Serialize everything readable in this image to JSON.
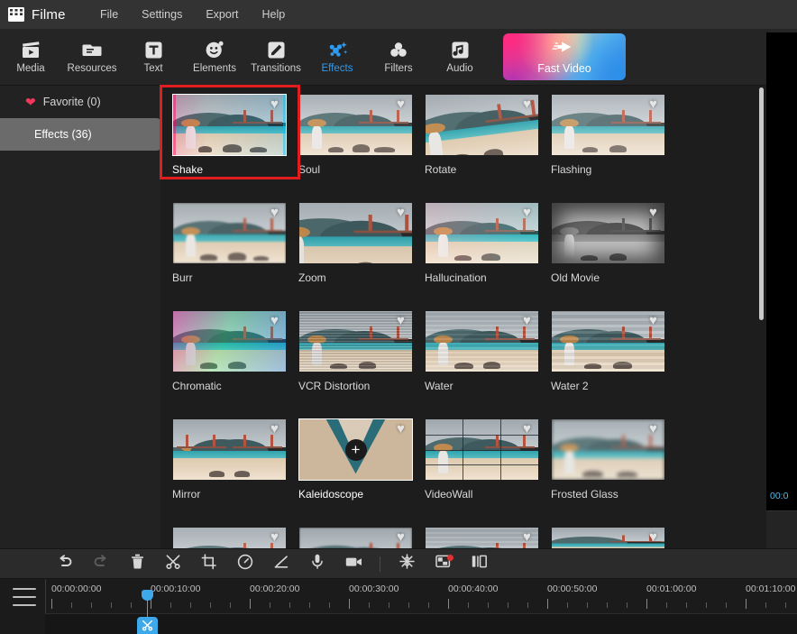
{
  "app": {
    "brand": "Filme",
    "menu": [
      "File",
      "Settings",
      "Export",
      "Help"
    ]
  },
  "ribbon": {
    "tabs": [
      {
        "label": "Media",
        "icon": "media-clapperboard-icon",
        "active": false
      },
      {
        "label": "Resources",
        "icon": "resources-folder-icon",
        "active": false
      },
      {
        "label": "Text",
        "icon": "text-t-icon",
        "active": false
      },
      {
        "label": "Elements",
        "icon": "elements-smiley-icon",
        "active": false
      },
      {
        "label": "Transitions",
        "icon": "transitions-slash-icon",
        "active": false
      },
      {
        "label": "Effects",
        "icon": "effects-sparkle-icon",
        "active": true
      },
      {
        "label": "Filters",
        "icon": "filters-circles-icon",
        "active": false
      },
      {
        "label": "Audio",
        "icon": "audio-note-icon",
        "active": false
      }
    ],
    "fast_video": {
      "label": "Fast Video",
      "icon": "fast-arrow-icon"
    },
    "accent_color": "#2f9bf0"
  },
  "sidebar": {
    "items": [
      {
        "label": "Favorite (0)",
        "icon": "heart-icon",
        "selected": false
      },
      {
        "label": "Effects (36)",
        "icon": "",
        "selected": true
      }
    ],
    "favorite_icon_color": "#f2385a"
  },
  "effects_grid": {
    "selected": "Shake",
    "hovered": "Kaleidoscope",
    "add_icon": "plus-icon",
    "favorite_icon": "heart-outline-icon",
    "items": [
      {
        "name": "Shake",
        "style": "shake",
        "row": 1
      },
      {
        "name": "Soul",
        "style": "soul",
        "row": 1
      },
      {
        "name": "Rotate",
        "style": "rotate",
        "row": 1
      },
      {
        "name": "Flashing",
        "style": "flash",
        "row": 1
      },
      {
        "name": "Burr",
        "style": "burr",
        "row": 2
      },
      {
        "name": "Zoom",
        "style": "zoom",
        "row": 2
      },
      {
        "name": "Hallucination",
        "style": "hall",
        "row": 2
      },
      {
        "name": "Old Movie",
        "style": "old",
        "row": 2
      },
      {
        "name": "Chromatic",
        "style": "chrom",
        "row": 3
      },
      {
        "name": "VCR Distortion",
        "style": "vcr",
        "row": 3
      },
      {
        "name": "Water",
        "style": "water",
        "row": 3
      },
      {
        "name": "Water 2",
        "style": "water2",
        "row": 3
      },
      {
        "name": "Mirror",
        "style": "mirror",
        "row": 4
      },
      {
        "name": "Kaleidoscope",
        "style": "kal",
        "row": 4
      },
      {
        "name": "VideoWall",
        "style": "vwall",
        "row": 4
      },
      {
        "name": "Frosted Glass",
        "style": "frost",
        "row": 4
      },
      {
        "name": "",
        "style": "soul",
        "row": 5
      },
      {
        "name": "",
        "style": "burr",
        "row": 5
      },
      {
        "name": "",
        "style": "water",
        "row": 5
      },
      {
        "name": "",
        "style": "mirror",
        "row": 5
      }
    ]
  },
  "annotation": {
    "highlight_target": "Shake",
    "color": "#e21d1d"
  },
  "preview": {
    "timecode": "00:0"
  },
  "edit_toolbar": {
    "tools": [
      {
        "name": "undo-icon",
        "enabled": true
      },
      {
        "name": "redo-icon",
        "enabled": false
      },
      {
        "name": "delete-trash-icon",
        "enabled": true
      },
      {
        "name": "split-scissors-icon",
        "enabled": true
      },
      {
        "name": "crop-icon",
        "enabled": true
      },
      {
        "name": "speed-gauge-icon",
        "enabled": true
      },
      {
        "name": "color-pen-icon",
        "enabled": true
      },
      {
        "name": "microphone-icon",
        "enabled": true
      },
      {
        "name": "camera-icon",
        "enabled": true
      },
      {
        "name": "separator",
        "enabled": true
      },
      {
        "name": "effects-snowflake-icon",
        "enabled": true
      },
      {
        "name": "green-screen-icon",
        "enabled": true,
        "badge": true
      },
      {
        "name": "split-screen-icon",
        "enabled": true
      }
    ]
  },
  "timeline": {
    "menu_icon": "hamburger-icon",
    "ticks": [
      "00:00:00:00",
      "00:00:10:00",
      "00:00:20:00",
      "00:00:30:00",
      "00:00:40:00",
      "00:00:50:00",
      "00:01:00:00",
      "00:01:10:00"
    ],
    "playhead_time": "00:00:10:00",
    "playhead_icon": "split-scissors-icon",
    "playhead_color": "#3ea9ea"
  }
}
